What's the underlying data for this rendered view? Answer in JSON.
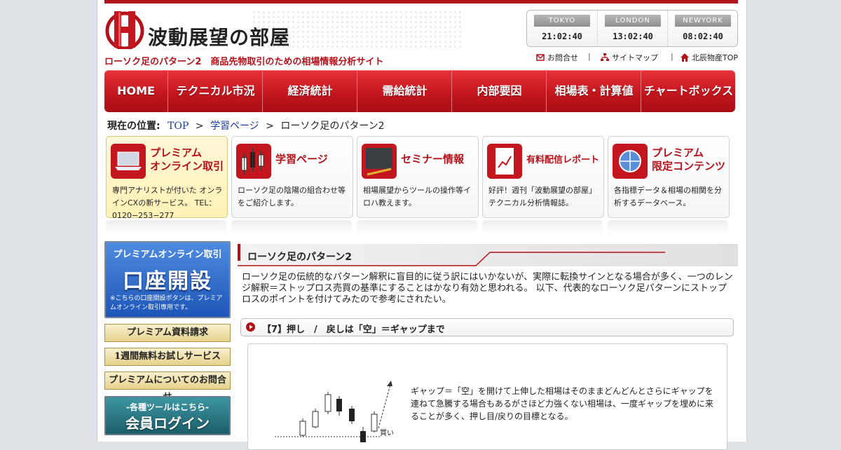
{
  "site": {
    "name": "波動展望の部屋",
    "tagline": "ローソク足のパターン2　商品先物取引のための相場情報分析サイト"
  },
  "clocks": [
    {
      "city": "TOKYO",
      "time": "21:02:40"
    },
    {
      "city": "LONDON",
      "time": "13:02:40"
    },
    {
      "city": "NEWYORK",
      "time": "08:02:40"
    }
  ],
  "utility": {
    "contact": "お問合せ",
    "sitemap": "サイトマップ",
    "hokushin": "北辰物産TOP",
    "sep": "|"
  },
  "nav": [
    "HOME",
    "テクニカル市況",
    "経済統計",
    "需給統計",
    "内部要因",
    "相場表・計算値",
    "チャートボックス"
  ],
  "breadcrumb": {
    "label": "現在の位置:",
    "items": [
      "TOP",
      "学習ページ",
      "ローソク足のパターン2"
    ],
    "sep": ">"
  },
  "cards": [
    {
      "title_line1": "プレミアム",
      "title_line2": "オンライン取引",
      "desc": "専門アナリストが付いた オンラインCXの新サービス。 TEL：0120−253−277"
    },
    {
      "title_line1": "学習ページ",
      "title_line2": "",
      "desc": "ローソク足の陰陽の組合わせ等をご紹介します。"
    },
    {
      "title_line1": "セミナー情報",
      "title_line2": "",
      "desc": "相場展望からツールの操作等イロハ教えます。"
    },
    {
      "title_line1": "有料配信レポート",
      "title_line2": "",
      "desc": "好評！週刊「波動展望の部屋」テクニカル分析情報誌。"
    },
    {
      "title_line1": "プレミアム",
      "title_line2": "限定コンテンツ",
      "desc": "各指標データ＆相場の相関を分析するデータベース。"
    }
  ],
  "sidebar": {
    "cta_top": "プレミアムオンライン取引",
    "cta_main": "口座開設",
    "cta_note": "※こちらの口座開設ボタンは、プレミアムオンライン取引専用です。",
    "buttons": [
      "プレミアム資料請求",
      "1週間無料お試しサービス",
      "プレミアムについてのお問合せ"
    ],
    "login_top": "-各種ツールはこちら-",
    "login_main": "会員ログイン"
  },
  "main": {
    "section_title": "ローソク足のパターン2",
    "intro": "ローソク足の伝統的なパターン解釈に盲目的に従う訳にはいかないが、実際に転換サインとなる場合が多く、一つのレンジ解釈＝ストップロス売買の基準にすることはかなり有効と思われる。 以下、代表的なローソク足パターンにストップロスのポイントを付けてみたので参考にされたい。",
    "subsection": "【7】押し　/　戻しは「空」＝ギャップまで",
    "chart_label": "買い",
    "description": "ギャップ＝「空」を開けて上伸した相場はそのままどんどんとさらにギャップを連ねて急騰する場合もあるがさほど力強くない相場は、一度ギャップを埋めに来ることが多く、押し目/戻りの目標となる。"
  },
  "colors": {
    "accent": "#b3121b",
    "link": "#1a3ea0",
    "cta_blue": "#1d56b8",
    "login_teal": "#1b5d69",
    "gold": "#e6d28c"
  }
}
